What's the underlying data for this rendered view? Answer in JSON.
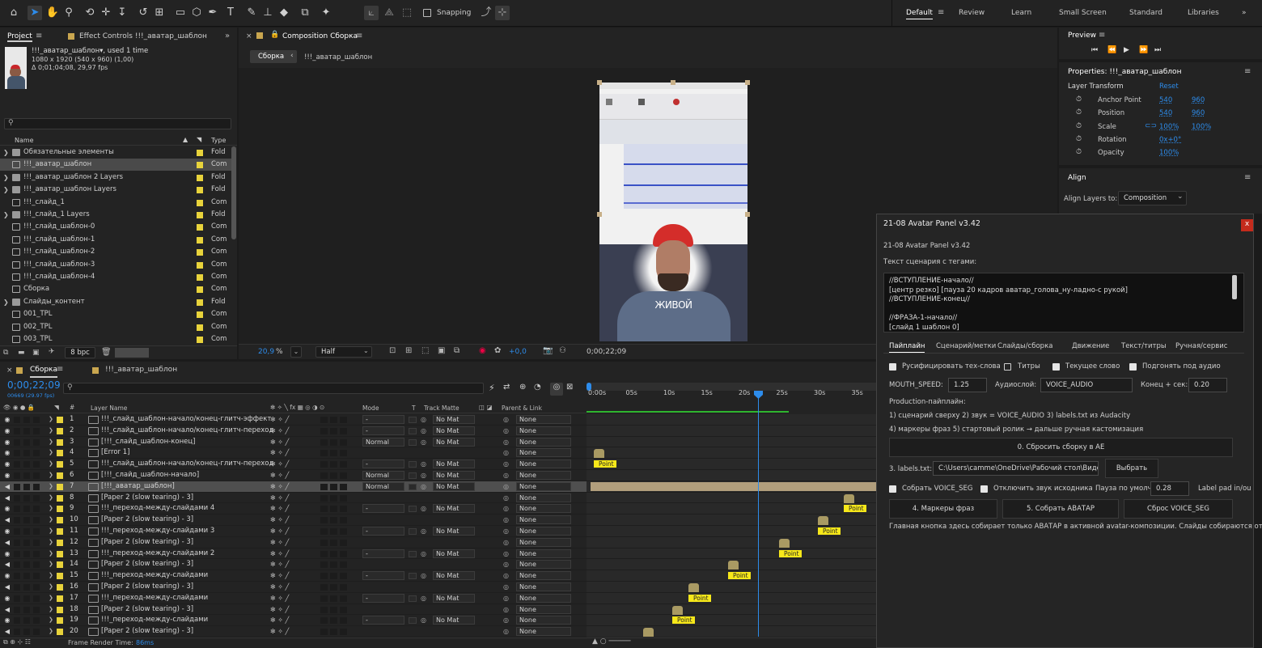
{
  "toolbar": {
    "snapping_label": "Snapping",
    "workspaces": [
      "Default",
      "Review",
      "Learn",
      "Small Screen",
      "Standard",
      "Libraries"
    ],
    "more": "»"
  },
  "project": {
    "tab_project": "Project",
    "tab_effect_controls": "Effect Controls !!!_аватар_шаблон",
    "item_name": "!!!_аватар_шаблон",
    "item_used": ", used 1 time",
    "item_dims": "1080 x 1920  (540 x 960) (1,00)",
    "item_duration": "Δ 0;01;04;08, 29,97 fps",
    "col_name": "Name",
    "col_type": "Type",
    "rows": [
      {
        "name": "Обязательные элементы",
        "type": "Fold",
        "folder": true
      },
      {
        "name": "!!!_аватар_шаблон",
        "type": "Com",
        "folder": false,
        "selected": true
      },
      {
        "name": "!!!_аватар_шаблон 2 Layers",
        "type": "Fold",
        "folder": true
      },
      {
        "name": "!!!_аватар_шаблон Layers",
        "type": "Fold",
        "folder": true
      },
      {
        "name": "!!!_слайд_1",
        "type": "Com",
        "folder": false
      },
      {
        "name": "!!!_слайд_1 Layers",
        "type": "Fold",
        "folder": true
      },
      {
        "name": "!!!_слайд_шаблон-0",
        "type": "Com",
        "folder": false
      },
      {
        "name": "!!!_слайд_шаблон-1",
        "type": "Com",
        "folder": false
      },
      {
        "name": "!!!_слайд_шаблон-2",
        "type": "Com",
        "folder": false
      },
      {
        "name": "!!!_слайд_шаблон-3",
        "type": "Com",
        "folder": false
      },
      {
        "name": "!!!_слайд_шаблон-4",
        "type": "Com",
        "folder": false
      },
      {
        "name": "Сборка",
        "type": "Com",
        "folder": false
      },
      {
        "name": "Слайды_контент",
        "type": "Fold",
        "folder": true
      },
      {
        "name": "001_TPL",
        "type": "Com",
        "folder": false
      },
      {
        "name": "002_TPL",
        "type": "Com",
        "folder": false
      },
      {
        "name": "003_TPL",
        "type": "Com",
        "folder": false
      }
    ],
    "bpc": "8 bpc"
  },
  "composition": {
    "tab": "Composition Сборка",
    "crumb_active": "Сборка",
    "crumb_next": "!!!_аватар_шаблон",
    "caption": "ЖИВОЙ",
    "zoom": "20,9",
    "zoom_unit": "%",
    "resolution": "Half",
    "exposure": "+0,0",
    "timecode": "0;00;22;09"
  },
  "preview": {
    "title": "Preview"
  },
  "properties": {
    "title": "Properties: !!!_аватар_шаблон",
    "section": "Layer Transform",
    "reset": "Reset",
    "props": [
      {
        "name": "Anchor Point",
        "v1": "540",
        "v2": "960"
      },
      {
        "name": "Position",
        "v1": "540",
        "v2": "960"
      },
      {
        "name": "Scale",
        "v1": "100%",
        "v2": "100%"
      },
      {
        "name": "Rotation",
        "v1": "0x+0°",
        "v2": ""
      },
      {
        "name": "Opacity",
        "v1": "100%",
        "v2": ""
      }
    ]
  },
  "align": {
    "title": "Align",
    "label": "Align Layers to:",
    "value": "Composition"
  },
  "timeline": {
    "tab_active": "Сборка",
    "tab_other": "!!!_аватар_шаблон",
    "timecode": "0;00;22;09",
    "frames": "00669 (29.97 fps)",
    "col_layer_name": "Layer Name",
    "col_mode": "Mode",
    "col_t": "T",
    "col_track_matte": "Track Matte",
    "col_parent": "Parent & Link",
    "ruler": [
      "0:00s",
      "05s",
      "10s",
      "15s",
      "20s",
      "25s",
      "30s",
      "35s"
    ],
    "point_label": "Point",
    "render_label": "Frame Render Time:",
    "render_value": "86ms",
    "layers": [
      {
        "n": "1",
        "name": "!!!_слайд_шаблон-начало/конец-глитч-эффект",
        "mode": "-",
        "tm": "No Mat",
        "parent": "None"
      },
      {
        "n": "2",
        "name": "!!!_слайд_шаблон-начало/конец-глитч-переход",
        "mode": "-",
        "tm": "No Mat",
        "parent": "None"
      },
      {
        "n": "3",
        "name": "[!!!_слайд_шаблон-конец]",
        "mode": "Normal",
        "tm": "No Mat",
        "parent": "None"
      },
      {
        "n": "4",
        "name": "[Error 1]",
        "mode": "",
        "tm": "",
        "parent": "None"
      },
      {
        "n": "5",
        "name": "!!!_слайд_шаблон-начало/конец-глитч-переход",
        "mode": "-",
        "tm": "No Mat",
        "parent": "None"
      },
      {
        "n": "6",
        "name": "[!!!_слайд_шаблон-начало]",
        "mode": "Normal",
        "tm": "No Mat",
        "parent": "None"
      },
      {
        "n": "7",
        "name": "[!!!_аватар_шаблон]",
        "mode": "Normal",
        "tm": "No Mat",
        "parent": "None"
      },
      {
        "n": "8",
        "name": "[Paper 2 (slow tearing) - 3]",
        "mode": "",
        "tm": "",
        "parent": "None"
      },
      {
        "n": "9",
        "name": "!!!_переход-между-слайдами 4",
        "mode": "-",
        "tm": "No Mat",
        "parent": "None"
      },
      {
        "n": "10",
        "name": "[Paper 2 (slow tearing) - 3]",
        "mode": "",
        "tm": "",
        "parent": "None"
      },
      {
        "n": "11",
        "name": "!!!_переход-между-слайдами 3",
        "mode": "-",
        "tm": "No Mat",
        "parent": "None"
      },
      {
        "n": "12",
        "name": "[Paper 2 (slow tearing) - 3]",
        "mode": "",
        "tm": "",
        "parent": "None"
      },
      {
        "n": "13",
        "name": "!!!_переход-между-слайдами 2",
        "mode": "-",
        "tm": "No Mat",
        "parent": "None"
      },
      {
        "n": "14",
        "name": "[Paper 2 (slow tearing) - 3]",
        "mode": "",
        "tm": "",
        "parent": "None"
      },
      {
        "n": "15",
        "name": "!!!_переход-между-слайдами",
        "mode": "-",
        "tm": "No Mat",
        "parent": "None"
      },
      {
        "n": "16",
        "name": "[Paper 2 (slow tearing) - 3]",
        "mode": "",
        "tm": "",
        "parent": "None"
      },
      {
        "n": "17",
        "name": "!!!_переход-между-слайдами",
        "mode": "-",
        "tm": "No Mat",
        "parent": "None"
      },
      {
        "n": "18",
        "name": "[Paper 2 (slow tearing) - 3]",
        "mode": "",
        "tm": "",
        "parent": "None"
      },
      {
        "n": "19",
        "name": "!!!_переход-между-слайдами",
        "mode": "-",
        "tm": "No Mat",
        "parent": "None"
      },
      {
        "n": "20",
        "name": "[Paper 2 (slow tearing) - 3]",
        "mode": "",
        "tm": "",
        "parent": "None"
      }
    ]
  },
  "avatar_panel": {
    "window_title": "21-08 Avatar Panel v3.42",
    "title": "21-08 Avatar Panel v3.42",
    "script_label": "Текст сценария с тегами:",
    "script_lines": [
      "//ВСТУПЛЕНИЕ-начало//",
      "[центр резко] [пауза 20 кадров аватар_голова_ну-ладно-с рукой]",
      "//ВСТУПЛЕНИЕ-конец//",
      "",
      "//ФРАЗА-1-начало//",
      "[слайд 1 шаблон 0]"
    ],
    "tabs": [
      "Пайплайн",
      "Сценарий/метки",
      "Слайды/сборка",
      "Движение",
      "Текст/титры",
      "Ручная/сервис"
    ],
    "cb_rus": "Русифицировать тех-слова",
    "cb_titles": "Титры",
    "cb_current_word": "Текущее слово",
    "cb_fit_audio": "Подгонять под аудио",
    "mouth_speed_label": "MOUTH_SPEED:",
    "mouth_speed_value": "1.25",
    "audio_layer_label": "Аудиослой:",
    "audio_layer_value": "VOICE_AUDIO",
    "end_label": "Конец + сек:",
    "end_value": "0.20",
    "pipeline_title": "Production-пайплайн:",
    "pipeline_line1": "1) сценарий сверху  2) звук = VOICE_AUDIO  3) labels.txt из Audacity",
    "pipeline_line2": "4) маркеры фраз  5) стартовый ролик → дальше ручная кастомизация",
    "btn_reset": "0. Сбросить сборку в AE",
    "labels_label": "3. labels.txt:",
    "labels_path": "C:\\Users\\camme\\OneDrive\\Рабочий стол\\Виде",
    "btn_choose": "Выбрать",
    "cb_collect_voice": "Собрать VOICE_SEG",
    "cb_mute_source": "Отключить звук исходника",
    "pause_label": "Пауза по умолч.:",
    "pause_value": "0.28",
    "label_pad": "Label pad in/ou",
    "btn_markers": "4. Маркеры фраз",
    "btn_collect_avatar": "5. Собрать АВАТАР",
    "btn_reset_voice": "Сброс VOICE_SEG",
    "footer": "Главная кнопка здесь собирает только АВАТАР в активной avatar-композиции. Слайды собираются от",
    "close": "x"
  }
}
